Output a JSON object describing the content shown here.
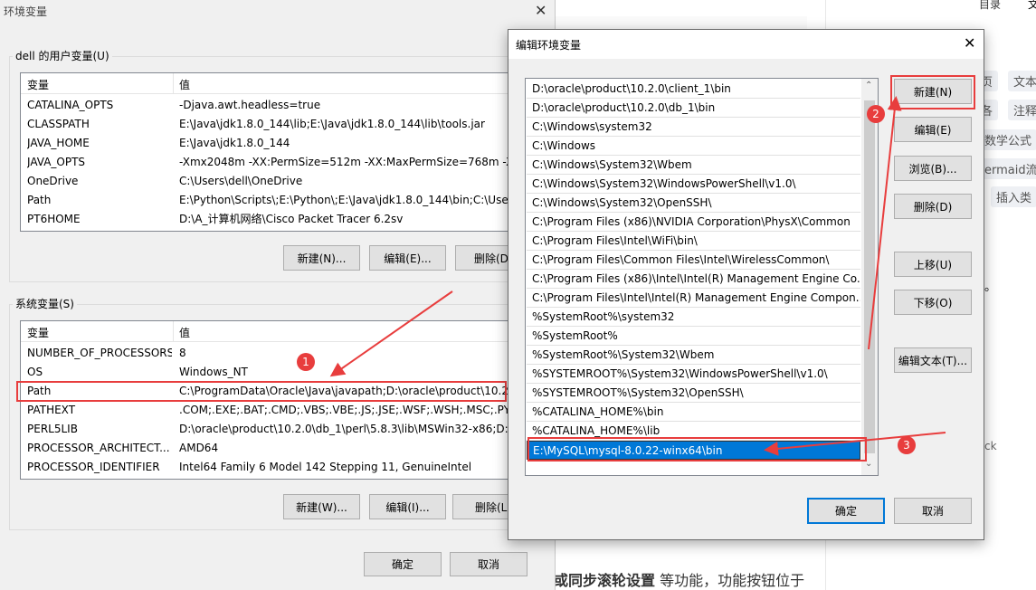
{
  "env_dialog": {
    "title": "环境变量",
    "user_group_label": "dell 的用户变量(U)",
    "system_group_label": "系统变量(S)",
    "col_var": "变量",
    "col_val": "值",
    "user_vars": [
      {
        "name": "CATALINA_OPTS",
        "value": "-Djava.awt.headless=true"
      },
      {
        "name": "CLASSPATH",
        "value": "E:\\Java\\jdk1.8.0_144\\lib;E:\\Java\\jdk1.8.0_144\\lib\\tools.jar"
      },
      {
        "name": "JAVA_HOME",
        "value": "E:\\Java\\jdk1.8.0_144"
      },
      {
        "name": "JAVA_OPTS",
        "value": "-Xmx2048m -XX:PermSize=512m -XX:MaxPermSize=768m -X..."
      },
      {
        "name": "OneDrive",
        "value": "C:\\Users\\dell\\OneDrive"
      },
      {
        "name": "Path",
        "value": "E:\\Python\\Scripts\\;E:\\Python\\;E:\\Java\\jdk1.8.0_144\\bin;C:\\User..."
      },
      {
        "name": "PT6HOME",
        "value": "D:\\A_计算机网络\\Cisco Packet Tracer 6.2sv"
      }
    ],
    "system_vars": [
      {
        "name": "NUMBER_OF_PROCESSORS",
        "value": "8"
      },
      {
        "name": "OS",
        "value": "Windows_NT"
      },
      {
        "name": "Path",
        "value": "C:\\ProgramData\\Oracle\\Java\\javapath;D:\\oracle\\product\\10.2..."
      },
      {
        "name": "PATHEXT",
        "value": ".COM;.EXE;.BAT;.CMD;.VBS;.VBE;.JS;.JSE;.WSF;.WSH;.MSC;.PY;.P..."
      },
      {
        "name": "PERL5LIB",
        "value": "D:\\oracle\\product\\10.2.0\\db_1\\perl\\5.8.3\\lib\\MSWin32-x86;D:..."
      },
      {
        "name": "PROCESSOR_ARCHITECT...",
        "value": "AMD64"
      },
      {
        "name": "PROCESSOR_IDENTIFIER",
        "value": "Intel64 Family 6 Model 142 Stepping 11, GenuineIntel"
      }
    ],
    "user_buttons": {
      "new": "新建(N)...",
      "edit": "编辑(E)...",
      "delete": "删除(D"
    },
    "system_buttons": {
      "new": "新建(W)...",
      "edit": "编辑(I)...",
      "delete": "删除(L"
    },
    "ok": "确定",
    "cancel": "取消"
  },
  "edit_dialog": {
    "title": "编辑环境变量",
    "paths": [
      "D:\\oracle\\product\\10.2.0\\client_1\\bin",
      "D:\\oracle\\product\\10.2.0\\db_1\\bin",
      "C:\\Windows\\system32",
      "C:\\Windows",
      "C:\\Windows\\System32\\Wbem",
      "C:\\Windows\\System32\\WindowsPowerShell\\v1.0\\",
      "C:\\Windows\\System32\\OpenSSH\\",
      "C:\\Program Files (x86)\\NVIDIA Corporation\\PhysX\\Common",
      "C:\\Program Files\\Intel\\WiFi\\bin\\",
      "C:\\Program Files\\Common Files\\Intel\\WirelessCommon\\",
      "C:\\Program Files (x86)\\Intel\\Intel(R) Management Engine Co...",
      "C:\\Program Files\\Intel\\Intel(R) Management Engine Compon...",
      "%SystemRoot%\\system32",
      "%SystemRoot%",
      "%SystemRoot%\\System32\\Wbem",
      "%SYSTEMROOT%\\System32\\WindowsPowerShell\\v1.0\\",
      "%SYSTEMROOT%\\System32\\OpenSSH\\",
      "%CATALINA_HOME%\\bin",
      "%CATALINA_HOME%\\lib",
      "E:\\MySQL\\mysql-8.0.22-winx64\\bin"
    ],
    "buttons": {
      "new": "新建(N)",
      "edit": "编辑(E)",
      "browse": "浏览(B)...",
      "delete": "删除(D)",
      "up": "上移(U)",
      "down": "下移(O)",
      "edit_text": "编辑文本(T)..."
    },
    "ok": "确定",
    "cancel": "取消"
  },
  "annotations": [
    "1",
    "2",
    "3"
  ],
  "background_page": {
    "toc": "目录",
    "tags": [
      "文本",
      "注释",
      "数学公式",
      "ermaid流",
      "插入类"
    ],
    "tags_left": [
      "页",
      "各"
    ],
    "footer_text_bold": "或同步滚轮设置",
    "footer_text_rest": " 等功能，功能按钮位于",
    "stray_dot": "。",
    "stray_ck": "ck",
    "small_buttons": [
      "新建",
      "编辑",
      "删除"
    ],
    "top_right_glyph": "文"
  },
  "colors": {
    "accent": "#0078d7",
    "annotation": "#e83d3d",
    "dialog_bg": "#f0f0f0"
  }
}
